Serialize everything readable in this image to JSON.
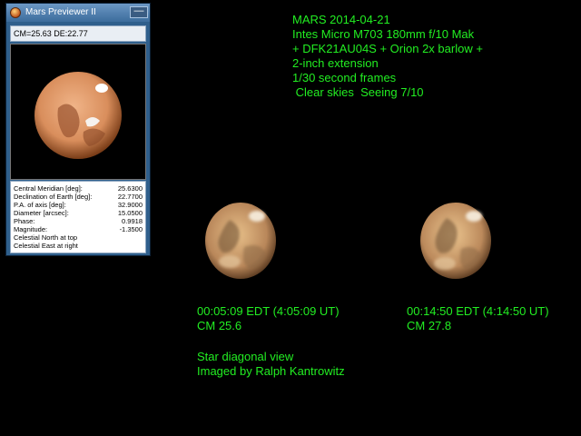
{
  "window": {
    "title": "Mars Previewer II",
    "minimize_label": "—",
    "coordinates": "CM=25.63 DE:22.77",
    "info_rows": [
      {
        "label": "Central Meridian [deg]:",
        "value": "25.6300"
      },
      {
        "label": "Declination of Earth [deg]:",
        "value": "22.7700"
      },
      {
        "label": "P.A. of axis [deg]:",
        "value": "32.9000"
      },
      {
        "label": "Diameter [arcsec]:",
        "value": "15.0500"
      },
      {
        "label": "Phase:",
        "value": "0.9918"
      },
      {
        "label": "Magnitude:",
        "value": "-1.3500"
      }
    ],
    "info_notes": [
      "Celestial North at top",
      "Celestial East at right"
    ]
  },
  "notes": {
    "lines": [
      "MARS 2014-04-21",
      "Intes Micro M703 180mm f/10 Mak",
      "+ DFK21AU04S + Orion 2x barlow +",
      "2-inch extension",
      "1/30 second frames",
      " Clear skies  Seeing 7/10"
    ]
  },
  "captions": [
    {
      "time": "00:05:09 EDT (4:05:09 UT)",
      "cm": "CM 25.6"
    },
    {
      "time": "00:14:50 EDT (4:14:50 UT)",
      "cm": "CM 27.8"
    }
  ],
  "credits": {
    "view": "Star diagonal view",
    "imager": "Imaged by Ralph Kantrowitz"
  },
  "colors": {
    "overlay_text": "#22ee22",
    "background": "#000000",
    "window_frame": "#2f5f8c"
  }
}
